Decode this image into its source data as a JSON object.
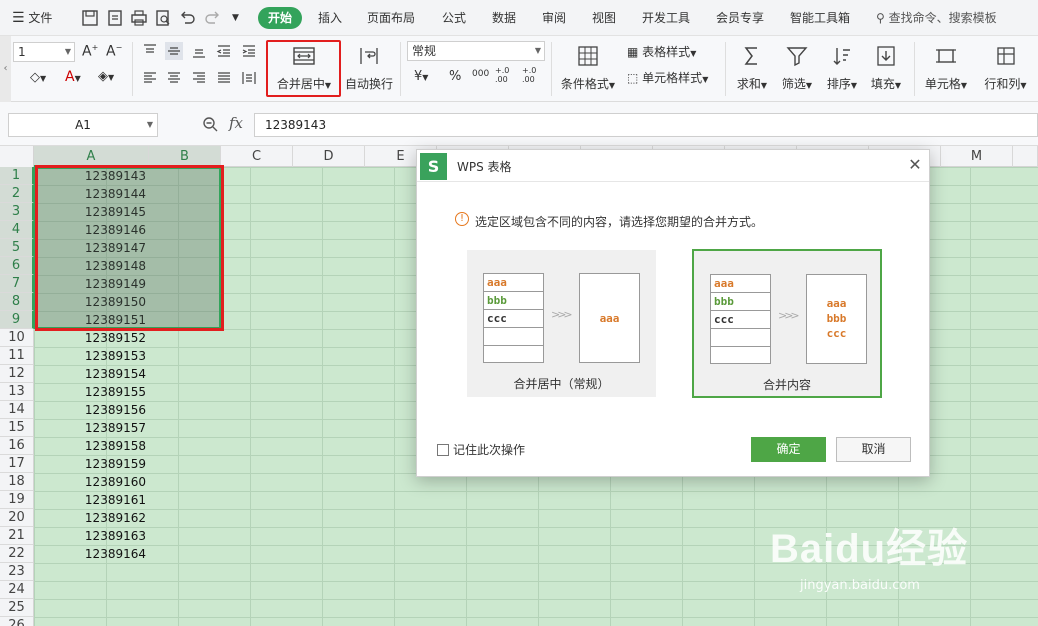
{
  "menubar": {
    "file_label": "文件",
    "tabs": [
      "开始",
      "插入",
      "页面布局",
      "公式",
      "数据",
      "审阅",
      "视图",
      "开发工具",
      "会员专享",
      "智能工具箱"
    ],
    "search_placeholder": "查找命令、搜索模板"
  },
  "ribbon": {
    "font_size": "1",
    "merge_center_label": "合并居中",
    "wrap_text_label": "自动换行",
    "number_format": "常规",
    "currency_symbol": "¥",
    "percent_symbol": "%",
    "thousands_symbol": "000",
    "inc_decimal_symbol": "+.0 .00",
    "dec_decimal_symbol": "+.0 .00",
    "conditional_format_label": "条件格式",
    "table_style_label": "表格样式",
    "cell_style_label": "单元格样式",
    "sum_label": "求和",
    "filter_label": "筛选",
    "sort_label": "排序",
    "fill_label": "填充",
    "cell_label": "单元格",
    "row_col_label": "行和列"
  },
  "formula_bar": {
    "cell_ref": "A1",
    "fx": "fx",
    "value": "12389143"
  },
  "sheet": {
    "columns": [
      "A",
      "B",
      "C",
      "D",
      "E",
      "M"
    ],
    "rows": [
      "1",
      "2",
      "3",
      "4",
      "5",
      "6",
      "7",
      "8",
      "9",
      "10",
      "11",
      "12",
      "13",
      "14",
      "15",
      "16",
      "17",
      "18",
      "19",
      "20",
      "21",
      "22",
      "23",
      "24",
      "25",
      "26"
    ],
    "col_a_values": [
      "12389143",
      "12389144",
      "12389145",
      "12389146",
      "12389147",
      "12389148",
      "12389149",
      "12389150",
      "12389151",
      "12389152",
      "12389153",
      "12389154",
      "12389155",
      "12389156",
      "12389157",
      "12389158",
      "12389159",
      "12389160",
      "12389161",
      "12389162",
      "12389163",
      "12389164"
    ]
  },
  "dialog": {
    "title": "WPS 表格",
    "message": "选定区域包含不同的内容，请选择您期望的合并方式。",
    "option_merge_center": {
      "label": "合并居中（常规）",
      "rows": [
        "aaa",
        "bbb",
        "ccc"
      ],
      "result": "aaa"
    },
    "option_merge_content": {
      "label": "合并内容",
      "rows": [
        "aaa",
        "bbb",
        "ccc"
      ],
      "result": [
        "aaa",
        "bbb",
        "ccc"
      ]
    },
    "remember_label": "记住此次操作",
    "ok_label": "确定",
    "cancel_label": "取消"
  },
  "watermark": {
    "logo": "Baidu经验",
    "url": "jingyan.baidu.com"
  },
  "colors": {
    "accent": "#33a35b",
    "highlight_red": "#e21e1e",
    "grid_green": "#cce8cf",
    "aaa_orange": "#d8792a",
    "bbb_green": "#5a9a3a"
  }
}
